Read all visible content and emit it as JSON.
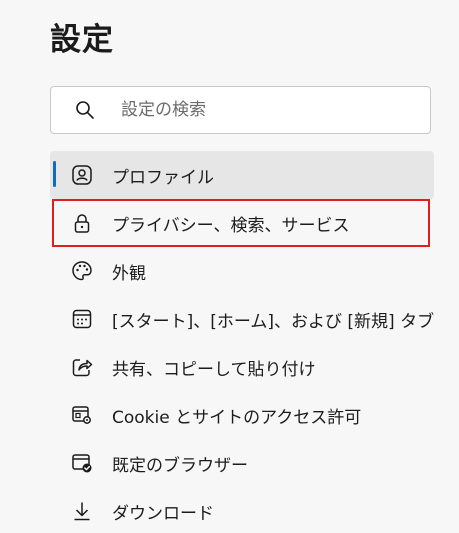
{
  "page": {
    "title": "設定"
  },
  "search": {
    "placeholder": "設定の検索",
    "value": ""
  },
  "colors": {
    "selected_indicator": "#0f6cbd",
    "selected_background": "#e6e6e6",
    "highlight_border": "#e01e1e"
  },
  "nav": {
    "items": [
      {
        "label": "プロファイル",
        "icon": "profile-icon",
        "selected": true
      },
      {
        "label": "プライバシー、検索、サービス",
        "icon": "lock-icon",
        "highlighted": true
      },
      {
        "label": "外観",
        "icon": "palette-icon"
      },
      {
        "label": "[スタート]、[ホーム]、および [新規] タブ",
        "icon": "new-tab-page-icon"
      },
      {
        "label": "共有、コピーして貼り付け",
        "icon": "share-icon"
      },
      {
        "label": "Cookie とサイトのアクセス許可",
        "icon": "site-permissions-icon"
      },
      {
        "label": "既定のブラウザー",
        "icon": "default-browser-icon"
      },
      {
        "label": "ダウンロード",
        "icon": "download-icon"
      }
    ]
  }
}
